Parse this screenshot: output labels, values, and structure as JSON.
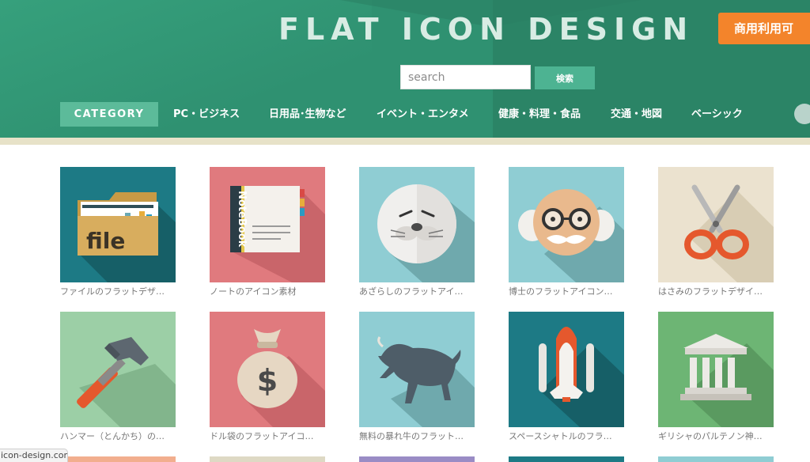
{
  "header": {
    "site_title": "FLAT ICON DESIGN",
    "commercial_badge": "商用利用可 ",
    "search": {
      "placeholder": "search",
      "button_label": "検索"
    }
  },
  "nav": {
    "category_label": "CATEGORY",
    "items": [
      "PC・ビジネス",
      "日用品･生物など",
      "イベント・エンタメ",
      "健康・料理・食品",
      "交通・地図",
      "ベーシック"
    ]
  },
  "icons": [
    {
      "caption": "ファイルのフラットデザ…",
      "icon": "file-folder-icon",
      "bg": "#1d7a85",
      "file_label": "file"
    },
    {
      "caption": "ノートのアイコン素材",
      "icon": "notebook-icon",
      "bg": "#e07a7e",
      "notebook_label": "NoteBook"
    },
    {
      "caption": "あざらしのフラットアイ…",
      "icon": "seal-icon",
      "bg": "#8fcdd3"
    },
    {
      "caption": "博士のフラットアイコン…",
      "icon": "professor-icon",
      "bg": "#8fcdd3"
    },
    {
      "caption": "はさみのフラットデザイ…",
      "icon": "scissors-icon",
      "bg": "#ebe2cf"
    },
    {
      "caption": "ハンマー（とんかち）の…",
      "icon": "hammer-icon",
      "bg": "#9ccfa6"
    },
    {
      "caption": "ドル袋のフラットアイコ…",
      "icon": "money-bag-icon",
      "bg": "#e07a7e",
      "money_symbol": "$"
    },
    {
      "caption": "無料の暴れ牛のフラット…",
      "icon": "bull-icon",
      "bg": "#8fcdd3"
    },
    {
      "caption": "スペースシャトルのフラ…",
      "icon": "space-shuttle-icon",
      "bg": "#1d7a85"
    },
    {
      "caption": "ギリシャのパルテノン神…",
      "icon": "parthenon-icon",
      "bg": "#6db574"
    }
  ],
  "next_row_colors": [
    "#f2ae8e",
    "#ded9c4",
    "#9a8cc5",
    "#1d7a85",
    "#8fcdd3"
  ],
  "status_bar": "icon-design.com"
}
